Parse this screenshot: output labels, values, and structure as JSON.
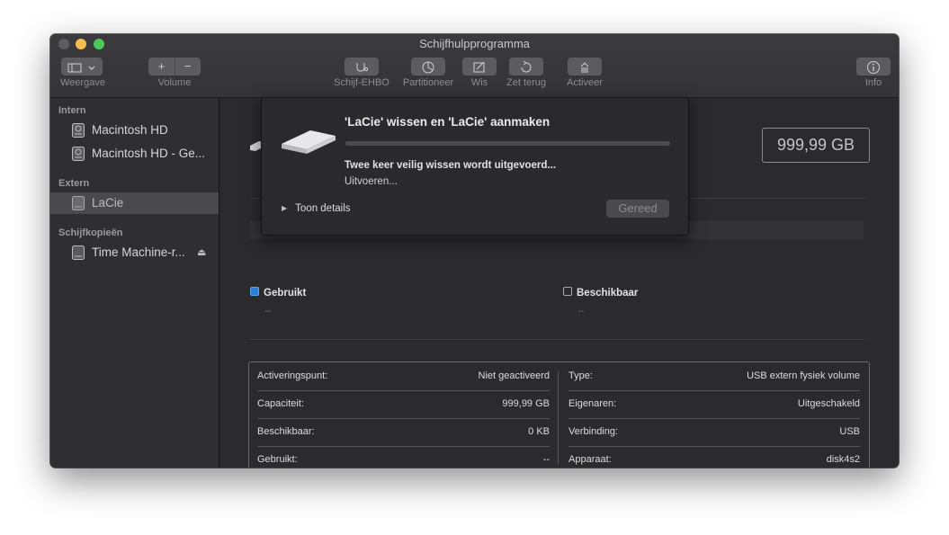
{
  "window": {
    "title": "Schijfhulpprogramma"
  },
  "toolbar": {
    "view_label": "Weergave",
    "volume_label": "Volume",
    "volume_add": "+",
    "volume_remove": "−",
    "first_aid_label": "Schijf-EHBO",
    "partition_label": "Partitioneer",
    "erase_label": "Wis",
    "restore_label": "Zet terug",
    "mount_label": "Activeer",
    "info_label": "Info"
  },
  "sidebar": {
    "sections": [
      {
        "title": "Intern"
      },
      {
        "title": "Extern"
      },
      {
        "title": "Schijfkopieën"
      }
    ],
    "items": [
      {
        "label": "Macintosh HD"
      },
      {
        "label": "Macintosh HD - Ge..."
      },
      {
        "label": "LaCie"
      },
      {
        "label": "Time Machine-r..."
      }
    ]
  },
  "main": {
    "capacity_badge": "999,99 GB",
    "legend": {
      "used_label": "Gebruikt",
      "used_value": "--",
      "available_label": "Beschikbaar",
      "available_value": "--",
      "used_color": "#2d7fd3"
    },
    "info_left": [
      {
        "key": "Activeringspunt:",
        "value": "Niet geactiveerd"
      },
      {
        "key": "Capaciteit:",
        "value": "999,99 GB"
      },
      {
        "key": "Beschikbaar:",
        "value": "0 KB"
      },
      {
        "key": "Gebruikt:",
        "value": "--"
      }
    ],
    "info_right": [
      {
        "key": "Type:",
        "value": "USB extern fysiek volume"
      },
      {
        "key": "Eigenaren:",
        "value": "Uitgeschakeld"
      },
      {
        "key": "Verbinding:",
        "value": "USB"
      },
      {
        "key": "Apparaat:",
        "value": "disk4s2"
      }
    ]
  },
  "sheet": {
    "title": "'LaCie' wissen en 'LaCie' aanmaken",
    "status": "Twee keer veilig wissen wordt uitgevoerd...",
    "substatus": "Uitvoeren...",
    "details_label": "Toon details",
    "done_label": "Gereed"
  }
}
